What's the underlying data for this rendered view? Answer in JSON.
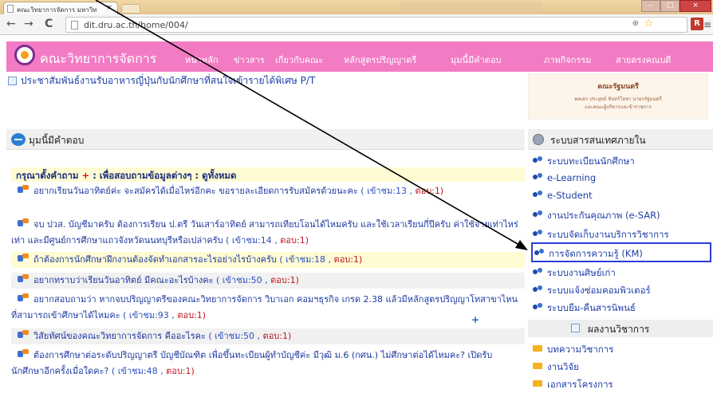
{
  "browser": {
    "tab_title": "คณะวิทยาการจัดการ มหาวิท",
    "tab_close": "×",
    "url": "dit.dru.ac.th/home/004/",
    "back": "←",
    "forward": "→",
    "reload": "C",
    "zoom_icon": "⊕",
    "star_icon": "☆",
    "extension_label": "R",
    "menu_icon": "≡",
    "win_min": "‒",
    "win_max": "□",
    "win_close": "×"
  },
  "site": {
    "name": "คณะวิทยาการจัดการ",
    "nav": [
      "หน้าหลัก",
      "ข่าวสาร",
      "เกี่ยวกับคณะ",
      "หลักสูตรปริญญาตรี",
      "มุมนี้มีคำตอบ",
      "ภาพกิจกรรม",
      "สายตรงคณบดี"
    ],
    "top_news": "ประชาสัมพันธ์งานรับอาหารญี่ปุ่นกับนักศึกษาที่สนใจเข้ารายได้พิเศษ P/T",
    "banner": {
      "title": "คณะรัฐมนตรี",
      "line1": "พลเอก ประยุทธ์ จันทร์โอชา นายกรัฐมนตรี",
      "line2": "และคณะผู้บริหารและข้าราชการ"
    }
  },
  "main": {
    "header": "มุมนี้มีคำตอบ",
    "ask_prefix": "กรุณาตั้งคำถาม",
    "ask_plus": "+",
    "ask_middle": ":   เพื่อสอบถามข้อมูลต่างๆ   :",
    "ask_all": "ดูทั้งหมด",
    "questions": [
      {
        "text": "อยากเรียนวันอาทิตย์ค่ะ จะสมัครได้เมื่อไหร่อีกคะ ขอรายละเอียดการรับสมัครด้วยนะคะ",
        "visits": "( เข้าชม:13 ,",
        "answers": "ตอบ:1)"
      },
      {
        "text": "จบ ปวส. บัญชีมาครับ ต้องการเรียน ป.ตรี วันเสาร์อาทิตย์ สามารถเทียบโอนได้ไหมครับ และใช้เวลาเรียนกี่ปีครับ ค่าใช้จ่ายเท่าไหร่เท่า และมีศูนย์การศึกษาแถวจังหวัดนนทบุรีหรือเปล่าครับ",
        "visits": "( เข้าชม:14 ,",
        "answers": "ตอบ:1)"
      },
      {
        "text": "ถ้าต้องการนักศึกษาฝึกงานต้องจัดทำเอกสารอะไรอย่างไรบ้างครับ",
        "visits": "( เข้าชม:18 ,",
        "answers": "ตอบ:1)"
      },
      {
        "text": "อยากทราบว่าเรียนวันอาทิตย์ มีคณะอะไรบ้างคะ",
        "visits": "( เข้าชม:50 ,",
        "answers": "ตอบ:1)"
      },
      {
        "text": "อยากสอบถามว่า หากจบปริญญาตรีของคณะวิทยาการจัดการ วิบาเอก คอมฯธุรกิจ เกรด 2.38 แล้วมีหลักสูตรปริญญาโทสาขาไหน ที่สามารถเข้าศึกษาได้ไหมคะ",
        "visits": "( เข้าชม:93 ,",
        "answers": "ตอบ:1)"
      },
      {
        "text": "วิสัยทัศน์ของคณะวิทยาการจัดการ คืออะไรคะ",
        "visits": "( เข้าชม:50 ,",
        "answers": "ตอบ:1)"
      },
      {
        "text": "ต้องการศึกษาต่อระดับปริญญาตรี บัญชีบัณฑิต เพื่อขึ้นทะเบียนผู้ทำบัญชีค่ะ มีวุฒิ ม.6 (กศน.) ไม่ศึกษาต่อได้ไหมคะ? เปิดรับนักศึกษาอีกครั้งเมื่อใดคะ?",
        "visits": "( เข้าชม:48 ,",
        "answers": "ตอบ:1)"
      }
    ],
    "cursor_mark": "+"
  },
  "sidebar": {
    "header": "ระบบสารสนเทศภายใน",
    "items": [
      "ระบบทะเบียนนักศึกษา",
      "e-Learning",
      "e-Student",
      "งานประกันคุณภาพ (e-SAR)",
      "ระบบจัดเก็บงานบริการวิชาการ",
      "การจัดการความรู้ (KM)",
      "ระบบงานศิษย์เก่า",
      "ระบบแจ้งซ่อมคอมพิวเตอร์",
      "ระบบยืม-คืนสารนิพนธ์"
    ],
    "works_header": "ผลงานวิชาการ",
    "works": [
      "บทความวิชาการ",
      "งานวิจัย",
      "เอกสารโครงการ"
    ]
  },
  "colors": {
    "brand_pink": "#f27bc4",
    "link_blue": "#1e3aa0",
    "answer_red": "#c0171e",
    "highlight_box": "#2b3dd8",
    "annotation_arrow": "#000000"
  }
}
